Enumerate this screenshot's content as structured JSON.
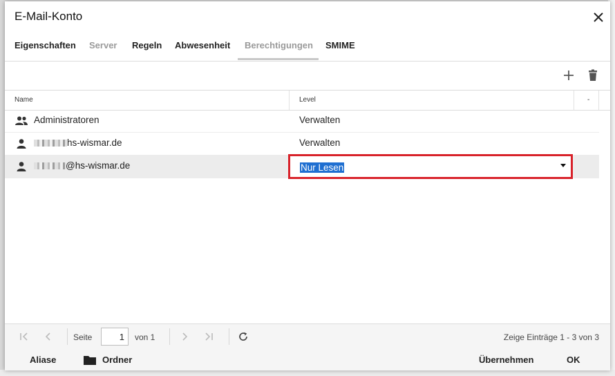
{
  "dialog": {
    "title": "E-Mail-Konto",
    "close_icon": "close-icon"
  },
  "tabs": [
    {
      "label": "Eigenschaften",
      "active": false
    },
    {
      "label": "Server",
      "active": false,
      "disabled": true
    },
    {
      "label": "Regeln",
      "active": false
    },
    {
      "label": "Abwesenheit",
      "active": false
    },
    {
      "label": "Berechtigungen",
      "active": true,
      "disabled": true
    },
    {
      "label": "SMIME",
      "active": false
    }
  ],
  "toolbar": {
    "add_icon": "plus-icon",
    "delete_icon": "trash-icon"
  },
  "grid": {
    "columns": [
      "Name",
      "Level",
      "-"
    ],
    "rows": [
      {
        "icon": "group-icon",
        "name": "Administratoren",
        "level": "Verwalten"
      },
      {
        "icon": "user-icon",
        "name_suffix": "hs-wismar.de",
        "name_prefix_redacted": true,
        "level": "Verwalten"
      },
      {
        "icon": "user-icon",
        "name_suffix": "@hs-wismar.de",
        "name_prefix_redacted": true,
        "level": "Nur Lesen",
        "selected": true
      }
    ],
    "editor": {
      "selected_value": "Nur Lesen"
    }
  },
  "pager": {
    "page_label": "Seite",
    "page_value": "1",
    "of_label": "von 1",
    "info": "Zeige Einträge 1 - 3 von 3"
  },
  "footer": {
    "aliase_label": "Aliase",
    "ordner_label": "Ordner",
    "apply_label": "Übernehmen",
    "ok_label": "OK"
  },
  "colors": {
    "highlight_border": "#d8222a",
    "selection": "#1f6fd1"
  }
}
